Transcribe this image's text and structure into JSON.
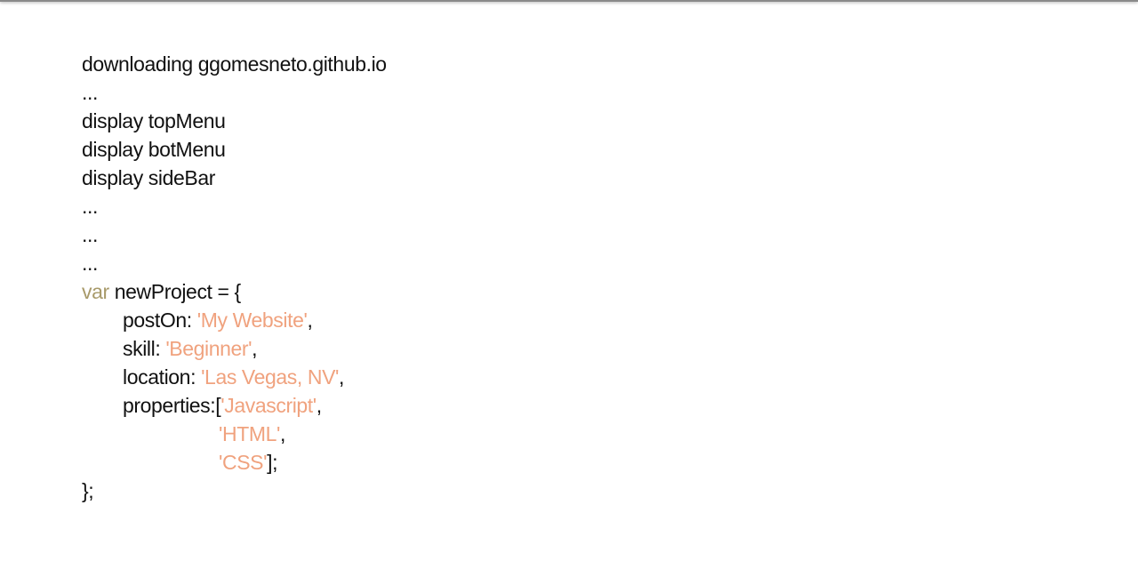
{
  "colors": {
    "keyword": "#a89a6a",
    "string": "#f0a27e",
    "text": "#111111",
    "background": "#ffffff"
  },
  "console": {
    "log_lines": [
      "downloading ggomesneto.github.io",
      "...",
      "display topMenu",
      "display botMenu",
      "display sideBar",
      "...",
      "...",
      "..."
    ],
    "code": {
      "keyword": "var",
      "declaration": " newProject = {",
      "post_on_key": "postOn: ",
      "post_on_value": "'My Website'",
      "skill_key": "skill: ",
      "skill_value": "'Beginner'",
      "location_key": "location: ",
      "location_value": "'Las Vegas, NV'",
      "properties_key": "properties:[",
      "properties": [
        "'Javascript'",
        "'HTML'",
        "'CSS'"
      ],
      "comma": ",",
      "array_close": "];",
      "closing": "};"
    }
  }
}
